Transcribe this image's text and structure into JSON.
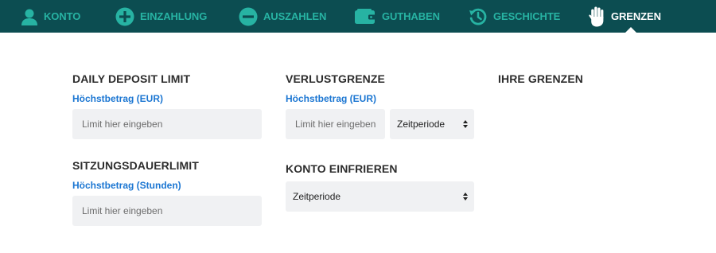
{
  "nav": {
    "items": [
      {
        "label": "KONTO",
        "icon": "user-icon"
      },
      {
        "label": "EINZAHLUNG",
        "icon": "plus-circle-icon"
      },
      {
        "label": "AUSZAHLEN",
        "icon": "minus-circle-icon"
      },
      {
        "label": "GUTHABEN",
        "icon": "wallet-icon"
      },
      {
        "label": "GESCHICHTE",
        "icon": "history-icon"
      },
      {
        "label": "GRENZEN",
        "icon": "hand-icon",
        "active": true
      }
    ],
    "colors": {
      "bar": "#0c4d51",
      "icon": "#27b3a3",
      "active": "#ffffff"
    }
  },
  "daily_deposit": {
    "title": "DAILY DEPOSIT LIMIT",
    "sublabel": "Höchstbetrag (EUR)",
    "placeholder": "Limit hier eingeben"
  },
  "session_limit": {
    "title": "SITZUNGSDAUERLIMIT",
    "sublabel": "Höchstbetrag (Stunden)",
    "placeholder": "Limit hier eingeben"
  },
  "loss_limit": {
    "title": "VERLUSTGRENZE",
    "sublabel": "Höchstbetrag (EUR)",
    "placeholder": "Limit hier eingeben",
    "period_select": "Zeitperiode"
  },
  "freeze": {
    "title": "KONTO EINFRIEREN",
    "period_select": "Zeitperiode"
  },
  "your_limits": {
    "title": "IHRE GRENZEN"
  },
  "colors": {
    "link_blue": "#1b76d2",
    "field_bg": "#f0f1f3",
    "heading": "#2d2d2d"
  }
}
